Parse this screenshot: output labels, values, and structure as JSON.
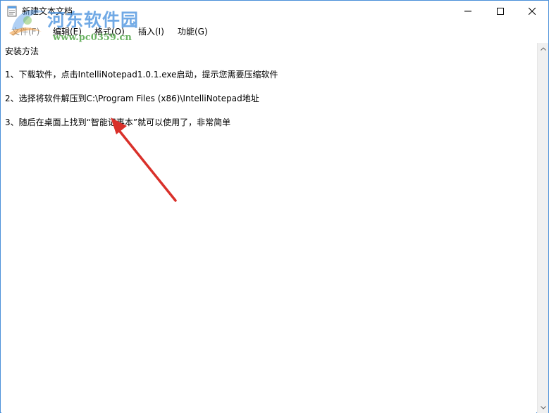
{
  "window": {
    "title": "新建文本文档"
  },
  "watermark": {
    "site_name": "河东软件园",
    "site_url": "www.pc0359.cn"
  },
  "menu": {
    "items": [
      {
        "label": "文件(F)"
      },
      {
        "label": "编辑(E)"
      },
      {
        "label": "格式(O)"
      },
      {
        "label": "插入(I)"
      },
      {
        "label": "功能(G)"
      }
    ]
  },
  "editor": {
    "lines": [
      "安装方法",
      "1、下载软件，点击IntelliNotepad1.0.1.exe启动，提示您需要压缩软件",
      "2、选择将软件解压到C:\\Program Files (x86)\\IntelliNotepad地址",
      "3、随后在桌面上找到“智能记事本”就可以使用了，非常简单"
    ]
  },
  "colors": {
    "window_border": "#4a90d9",
    "annotation_arrow": "#d9302a",
    "scrollbar_bg": "#f0f0f0"
  },
  "icons": {
    "app": "notepad-icon",
    "minimize": "minimize-icon",
    "maximize": "maximize-icon",
    "close": "close-icon",
    "scroll_up": "chevron-up-icon",
    "scroll_down": "chevron-down-icon"
  }
}
